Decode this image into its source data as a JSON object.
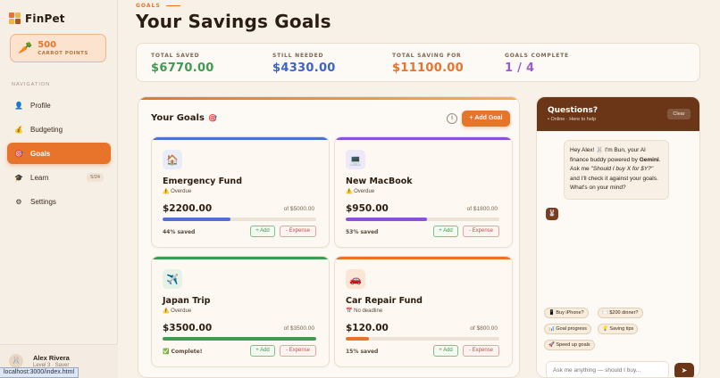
{
  "app": {
    "name": "FinPet"
  },
  "points": {
    "value": "500",
    "label": "CARROT POINTS",
    "icon": "carrot-icon"
  },
  "nav": {
    "title": "NAVIGATION",
    "items": [
      {
        "label": "Profile",
        "icon": "user-icon",
        "glyph": "👤"
      },
      {
        "label": "Budgeting",
        "icon": "money-bag-icon",
        "glyph": "💰"
      },
      {
        "label": "Goals",
        "icon": "target-icon",
        "glyph": "🎯",
        "active": true
      },
      {
        "label": "Learn",
        "icon": "graduation-cap-icon",
        "glyph": "🎓",
        "badge": "5/24"
      },
      {
        "label": "Settings",
        "icon": "gear-icon",
        "glyph": "⚙"
      }
    ]
  },
  "user": {
    "name": "Alex Rivera",
    "level": "Level 3 · Saver"
  },
  "status_url": "localhost:3000/index.html",
  "header": {
    "eyebrow": "GOALS",
    "title": "Your Savings Goals"
  },
  "stats": [
    {
      "label": "TOTAL SAVED",
      "value": "$6770.00",
      "color": "#3f9a52"
    },
    {
      "label": "STILL NEEDED",
      "value": "$4330.00",
      "color": "#3d63c7"
    },
    {
      "label": "TOTAL SAVING FOR",
      "value": "$11100.00",
      "color": "#e8742b"
    },
    {
      "label": "GOALS COMPLETE",
      "value": "1 / 4",
      "color": "#9a5cc9"
    }
  ],
  "goals": {
    "title": "Your Goals",
    "title_icon": "🎯",
    "add_label": "+ Add Goal",
    "info_label": "i",
    "add_btn": "+ Add",
    "expense_btn": "- Expense",
    "items": [
      {
        "name": "Emergency Fund",
        "icon": "house-icon",
        "glyph": "🏠",
        "status": "⚠️ Overdue",
        "saved": "$2200.00",
        "target": "of $5000.00",
        "progress": 0.44,
        "percent_text": "44% saved",
        "color": "#4f6fd1"
      },
      {
        "name": "New MacBook",
        "icon": "laptop-icon",
        "glyph": "💻",
        "status": "⚠️ Overdue",
        "saved": "$950.00",
        "target": "of $1800.00",
        "progress": 0.53,
        "percent_text": "53% saved",
        "color": "#8a52d6"
      },
      {
        "name": "Japan Trip",
        "icon": "airplane-icon",
        "glyph": "✈️",
        "status": "⚠️ Overdue",
        "saved": "$3500.00",
        "target": "of $3500.00",
        "progress": 1.0,
        "percent_text": "✅ Complete!",
        "color": "#3f9a52"
      },
      {
        "name": "Car Repair Fund",
        "icon": "car-icon",
        "glyph": "🚗",
        "status": "📅 No deadline",
        "saved": "$120.00",
        "target": "of $800.00",
        "progress": 0.15,
        "percent_text": "15% saved",
        "color": "#e8742b"
      }
    ]
  },
  "chat": {
    "title": "Questions?",
    "status": "• Online · Here to help",
    "clear_label": "Clear",
    "message": {
      "p1": "Hey Alex! 🐰 I'm Bun, your AI finance buddy powered by ",
      "strong": "Gemini",
      "p2": ".",
      "p3": "Ask me ",
      "em": "\"Should I buy X for $Y?\"",
      "p4": " and I'll check it against your goals. What's on your mind?"
    },
    "bot_avatar": "🐰",
    "chips": [
      "📱 Buy iPhone?",
      "🍽️ $200 dinner?",
      "📊 Goal progress",
      "💡 Saving tips",
      "🚀 Speed up goals"
    ],
    "input_placeholder": "Ask me anything — should I buy...",
    "send_icon": "➤"
  }
}
